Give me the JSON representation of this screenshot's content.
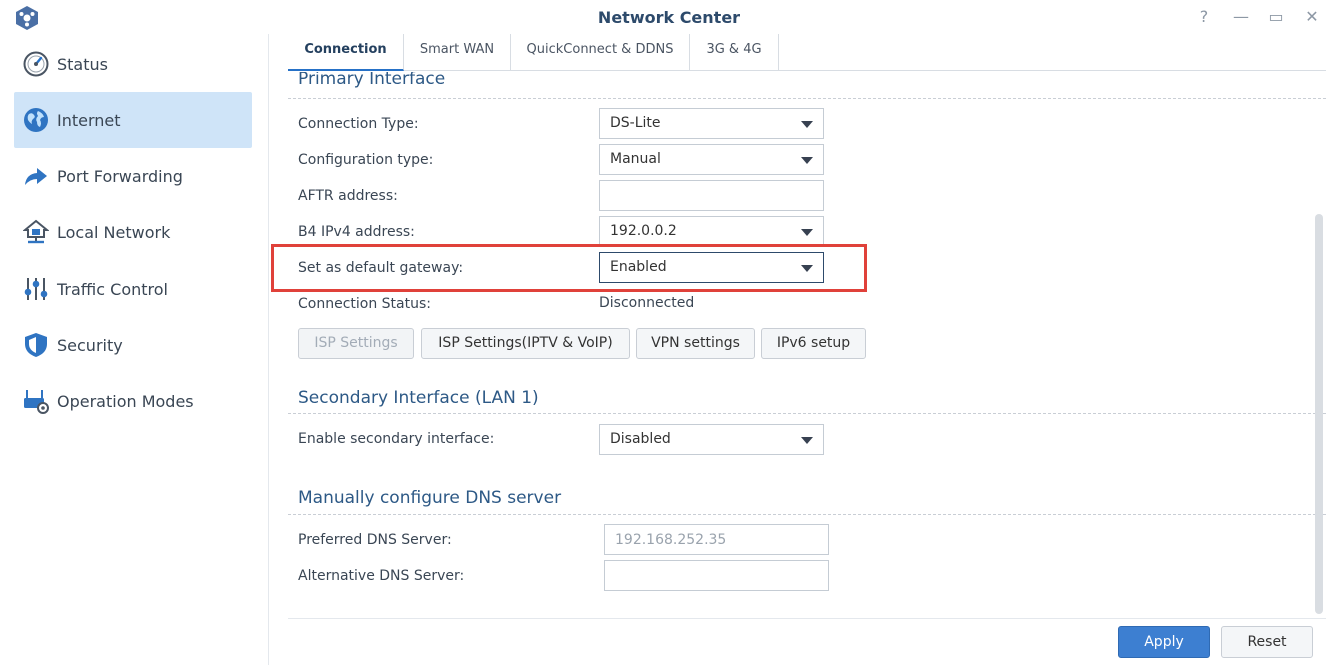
{
  "window": {
    "title": "Network Center",
    "help_glyph": "?",
    "minimize_glyph": "—",
    "maximize_glyph": "▭",
    "close_glyph": "✕"
  },
  "sidebar": {
    "items": [
      {
        "label": "Status",
        "icon": "gauge-icon",
        "active": false
      },
      {
        "label": "Internet",
        "icon": "globe-icon",
        "active": true
      },
      {
        "label": "Port Forwarding",
        "icon": "forward-arrow-icon",
        "active": false
      },
      {
        "label": "Local Network",
        "icon": "home-network-icon",
        "active": false
      },
      {
        "label": "Traffic Control",
        "icon": "sliders-icon",
        "active": false
      },
      {
        "label": "Security",
        "icon": "shield-icon",
        "active": false
      },
      {
        "label": "Operation Modes",
        "icon": "router-gear-icon",
        "active": false
      }
    ]
  },
  "tabs": [
    {
      "label": "Connection",
      "active": true
    },
    {
      "label": "Smart WAN",
      "active": false
    },
    {
      "label": "QuickConnect & DDNS",
      "active": false
    },
    {
      "label": "3G & 4G",
      "active": false
    }
  ],
  "primary": {
    "title": "Primary Interface",
    "connection_type_label": "Connection Type:",
    "connection_type_value": "DS-Lite",
    "config_type_label": "Configuration type:",
    "config_type_value": "Manual",
    "aftr_label": "AFTR address:",
    "aftr_value": "",
    "b4_label": "B4 IPv4 address:",
    "b4_value": "192.0.0.2",
    "gateway_label": "Set as default gateway:",
    "gateway_value": "Enabled",
    "status_label": "Connection Status:",
    "status_value": "Disconnected",
    "buttons": {
      "isp": "ISP Settings",
      "isp_iptv": "ISP Settings(IPTV & VoIP)",
      "vpn": "VPN settings",
      "ipv6": "IPv6 setup"
    }
  },
  "secondary": {
    "title": "Secondary Interface (LAN 1)",
    "enable_label": "Enable secondary interface:",
    "enable_value": "Disabled"
  },
  "dns": {
    "title": "Manually configure DNS server",
    "preferred_label": "Preferred DNS Server:",
    "preferred_placeholder": "192.168.252.35",
    "alternative_label": "Alternative DNS Server:",
    "alternative_value": ""
  },
  "footer": {
    "apply": "Apply",
    "reset": "Reset"
  },
  "colors": {
    "accent": "#3d7fd1",
    "active_nav": "#cfe4f8",
    "highlight": "#e0413a",
    "section_title": "#2d5986"
  }
}
